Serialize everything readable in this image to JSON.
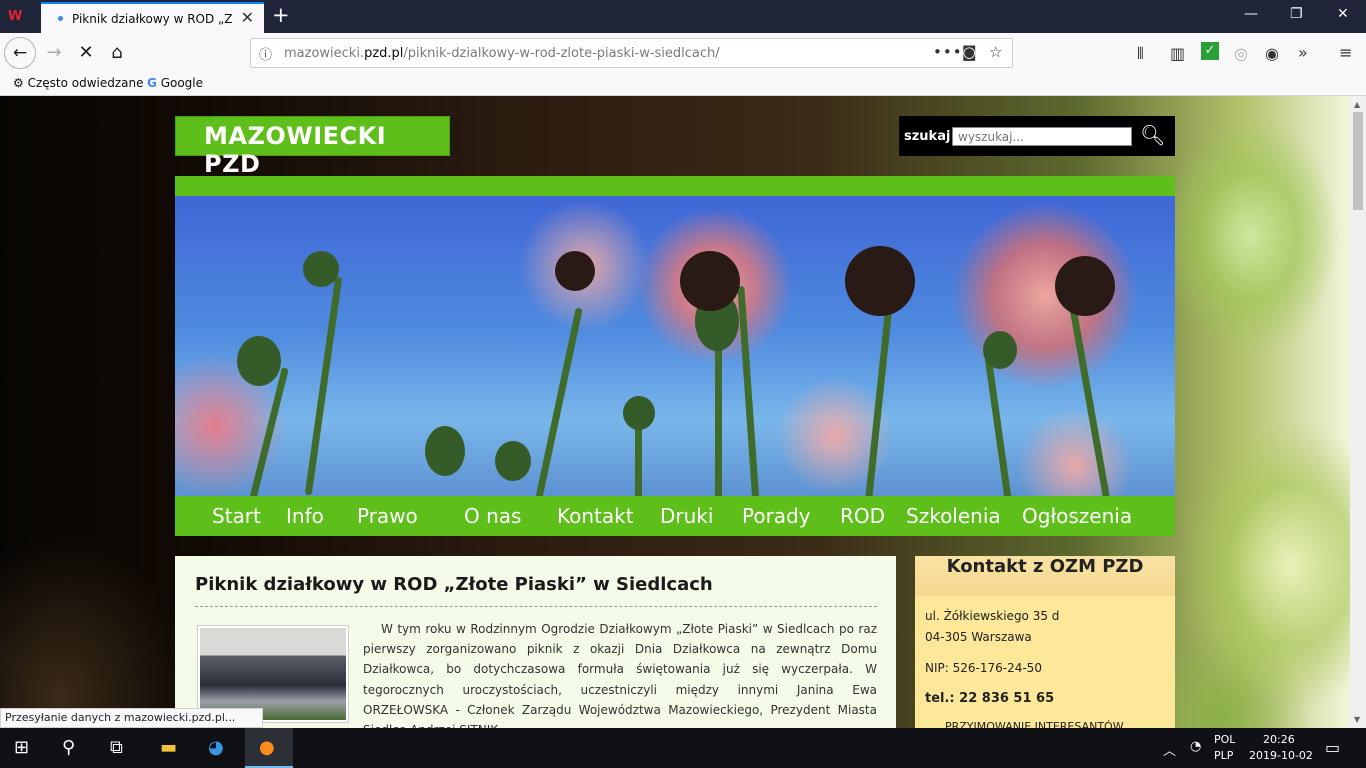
{
  "browser": {
    "tab_title": "Piknik działkowy w ROD „Złote",
    "url_host": "mazowiecki.pzd.pl",
    "url_path": "/piknik-dzialkowy-w-rod-zlote-piaski-w-siedlcach/",
    "url_prefix": "mazowiecki.",
    "url_domain": "pzd.pl",
    "bookmarks": [
      "Często odwiedzane",
      "Google"
    ],
    "status_text": "Przesyłanie danych z mazowiecki.pzd.pl..."
  },
  "site": {
    "logo": "MAZOWIECKI PZD",
    "search_label": "szukaj",
    "search_placeholder": "wyszukaj...",
    "menu": [
      "Start",
      "Info",
      "Prawo",
      "O nas",
      "Kontakt",
      "Druki",
      "Porady",
      "ROD",
      "Szkolenia",
      "Ogłoszenia"
    ]
  },
  "article": {
    "title": "Piknik działkowy w ROD „Złote Piaski” w Siedlcach",
    "body": "W tym roku w Rodzinnym Ogrodzie Działkowym „Złote Piaski” w Siedlcach po raz pierwszy zorganizowano piknik z okazji Dnia Działkowca na zewnątrz Domu Działkowca, bo dotychczasowa formuła świętowania już się wyczerpała. W tegorocznych uroczystościach, uczestniczyli między innymi Janina Ewa ORZEŁOWSKA - Członek Zarządu Województwa Mazowieckiego, Prezydent Miasta Siedlce Andrzej SITNIK,"
  },
  "sidebar": {
    "title": "Kontakt z OZM PZD",
    "address1": "ul. Żółkiewskiego 35 d",
    "address2": "04-305 Warszawa",
    "nip": "NIP: 526-176-24-50",
    "tel": "tel.: 22 836 51 65",
    "cut_line": "PRZYJMOWANIE INTERESANTÓW"
  },
  "taskbar": {
    "lang1": "POL",
    "lang2": "PLP",
    "time": "20:26",
    "date": "2019-10-02"
  }
}
